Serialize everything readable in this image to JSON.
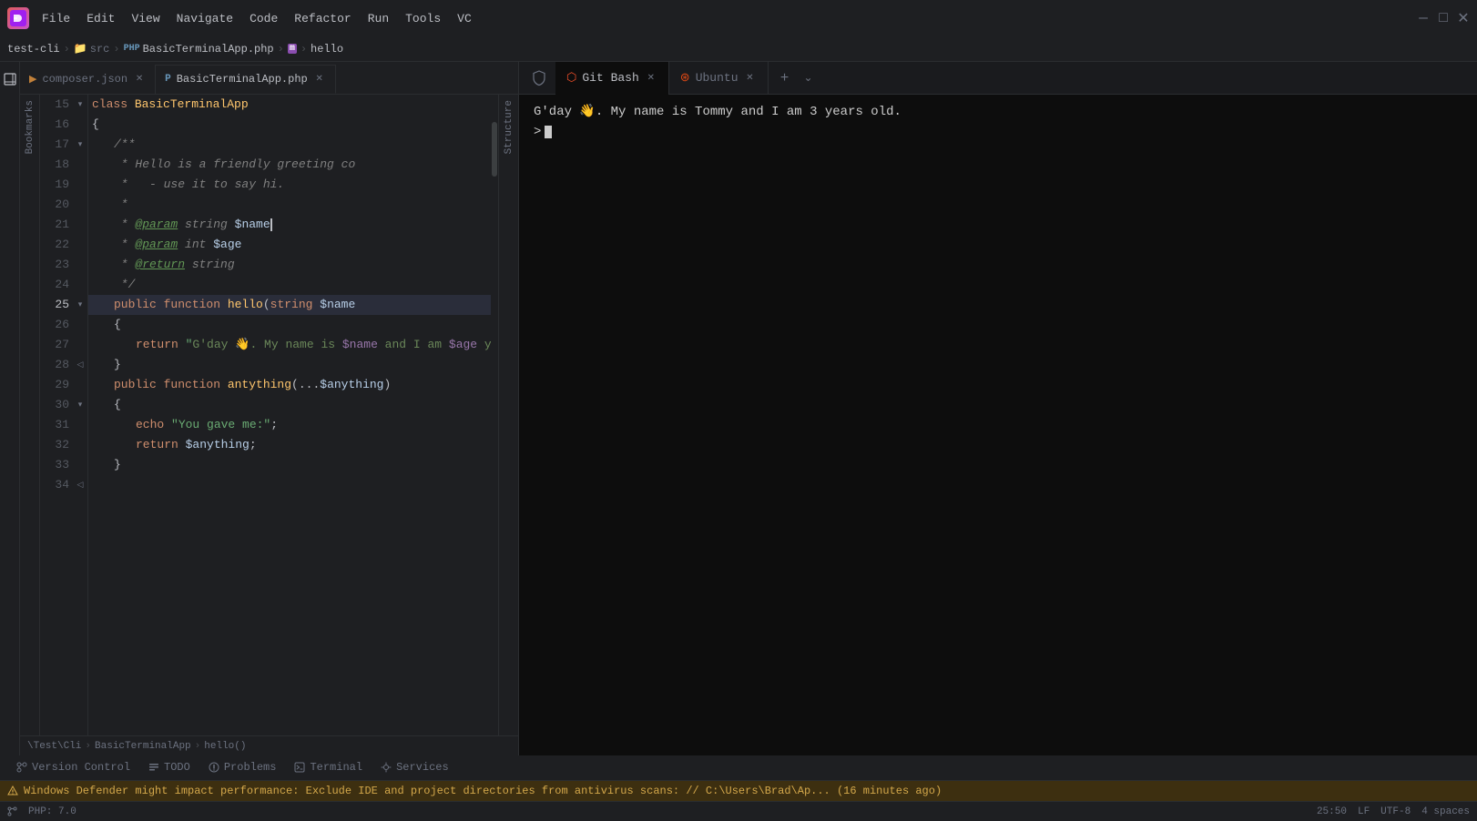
{
  "titlebar": {
    "appIconLabel": "P",
    "menus": [
      "File",
      "Edit",
      "View",
      "Navigate",
      "Code",
      "Refactor",
      "Run",
      "Tools",
      "VC"
    ],
    "windowTitle": "test-cli – src – BasicTerminalApp.php – hello",
    "winBtnMin": "—",
    "winBtnMax": "□",
    "winBtnClose": "✕"
  },
  "breadcrumb": {
    "items": [
      {
        "label": "test-cli",
        "icon": ""
      },
      {
        "label": "src",
        "icon": "📁"
      },
      {
        "label": "BasicTerminalApp.php",
        "icon": "PHP"
      },
      {
        "label": "m",
        "icon": ""
      },
      {
        "label": "hello",
        "icon": ""
      }
    ]
  },
  "tabs": [
    {
      "label": "composer.json",
      "type": "json",
      "active": false,
      "closeable": true
    },
    {
      "label": "BasicTerminalApp.php",
      "type": "php",
      "active": true,
      "closeable": true
    }
  ],
  "code": {
    "lines": [
      {
        "num": 15,
        "indent": 0,
        "fold": true,
        "content": "class BasicTerminalApp"
      },
      {
        "num": 16,
        "indent": 1,
        "fold": false,
        "content": "{"
      },
      {
        "num": 17,
        "indent": 2,
        "fold": true,
        "content": "/**"
      },
      {
        "num": 18,
        "indent": 2,
        "fold": false,
        "content": " * Hello is a friendly greeting co"
      },
      {
        "num": 19,
        "indent": 2,
        "fold": false,
        "content": " *   - use it to say hi."
      },
      {
        "num": 20,
        "indent": 2,
        "fold": false,
        "content": " *"
      },
      {
        "num": 21,
        "indent": 2,
        "fold": false,
        "content": " * @param string $name"
      },
      {
        "num": 22,
        "indent": 2,
        "fold": false,
        "content": " * @param int $age"
      },
      {
        "num": 23,
        "indent": 2,
        "fold": false,
        "content": " * @return string"
      },
      {
        "num": 24,
        "indent": 2,
        "fold": false,
        "content": " */"
      },
      {
        "num": 25,
        "indent": 2,
        "fold": true,
        "content": "public function hello(string $name"
      },
      {
        "num": 26,
        "indent": 2,
        "fold": false,
        "content": "{"
      },
      {
        "num": 27,
        "indent": 3,
        "fold": false,
        "content": "    return \"G'day 👋. My name is $name and I am $age years old.\";"
      },
      {
        "num": 28,
        "indent": 2,
        "fold": false,
        "content": "}"
      },
      {
        "num": 29,
        "indent": 0,
        "fold": false,
        "content": ""
      },
      {
        "num": 30,
        "indent": 2,
        "fold": true,
        "content": "public function antything(...$anything)"
      },
      {
        "num": 31,
        "indent": 2,
        "fold": false,
        "content": "{"
      },
      {
        "num": 32,
        "indent": 3,
        "fold": false,
        "content": "    echo \"You gave me:\";"
      },
      {
        "num": 33,
        "indent": 3,
        "fold": false,
        "content": "    return $anything;"
      },
      {
        "num": 34,
        "indent": 2,
        "fold": false,
        "content": "}"
      }
    ]
  },
  "editorBottomBreadcrumb": {
    "items": [
      "\\Test\\Cli",
      "BasicTerminalApp",
      "hello()"
    ]
  },
  "terminal": {
    "tabs": [
      {
        "label": "Git Bash",
        "active": true,
        "icon": "git"
      },
      {
        "label": "Ubuntu",
        "active": false,
        "icon": "ubuntu"
      }
    ],
    "output": "G'day 👋. My name is Tommy and I am 3 years old.",
    "prompt": ">"
  },
  "bottomTabs": [
    {
      "label": "Version Control",
      "icon": "git",
      "active": false
    },
    {
      "label": "TODO",
      "icon": "list",
      "active": false
    },
    {
      "label": "Problems",
      "icon": "warning",
      "active": false
    },
    {
      "label": "Terminal",
      "icon": "terminal",
      "active": false
    },
    {
      "label": "Services",
      "icon": "services",
      "active": false
    }
  ],
  "warningBar": {
    "message": "Windows Defender might impact performance: Exclude IDE and project directories from antivirus scans: // C:\\Users\\Brad\\Ap... (16 minutes ago)"
  },
  "statusBar": {
    "php": "PHP: 7.0",
    "line": "25:50",
    "lineEnding": "LF",
    "encoding": "UTF-8",
    "indent": "4 spaces"
  },
  "sideLabels": {
    "project": "Project",
    "bookmarks": "Bookmarks",
    "structure": "Structure"
  }
}
